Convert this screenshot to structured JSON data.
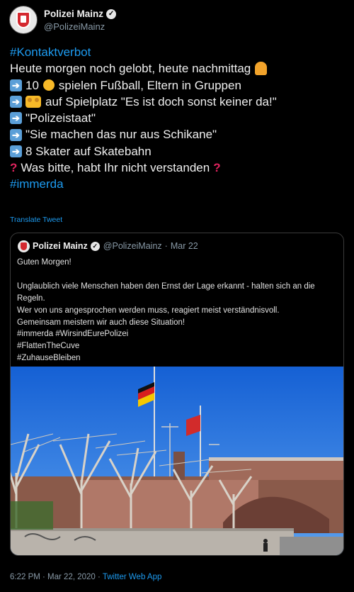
{
  "account": {
    "display_name": "Polizei Mainz",
    "handle": "@PolizeiMainz",
    "verified_mark": "✓"
  },
  "tweet": {
    "hashtag_top": "#Kontaktverbot",
    "line1": "Heute morgen noch gelobt, heute nachmittag",
    "line2_num": "10",
    "line2_text": "spielen Fußball, Eltern in Gruppen",
    "line3_text": "auf Spielplatz \"Es ist doch sonst keiner da!\"",
    "line4_text": "\"Polizeistaat\"",
    "line5_text": "\"Sie machen das nur aus Schikane\"",
    "line6_text": "8 Skater auf Skatebahn",
    "line7_text": "Was bitte, habt Ihr nicht verstanden",
    "hashtag_bottom": "#immerda",
    "icons": [
      "arrow-right-icon",
      "face-emoji",
      "people-emoji",
      "facepalm-emoji",
      "question-mark-icon"
    ]
  },
  "translate_label": "Translate Tweet",
  "quoted": {
    "display_name": "Polizei Mainz",
    "handle": "@PolizeiMainz",
    "date": "Mar 22",
    "separator": "·",
    "lines": [
      "Guten Morgen!",
      "",
      "Unglaublich viele Menschen haben den Ernst der Lage erkannt - halten sich an die Regeln.",
      "Wer von uns angesprochen werden muss, reagiert meist verständnisvoll.",
      "Gemeinsam meistern wir auch diese Situation!",
      "#immerda #WirsindEurePolizei",
      "#FlattenTheCuve",
      "#ZuhauseBleiben"
    ]
  },
  "footer": {
    "timestamp": "6:22 PM · Mar 22, 2020 ·",
    "source": "Twitter Web App"
  },
  "colors": {
    "background": "#000000",
    "link": "#1d9bf0",
    "muted": "#8899a6",
    "sky": "#1f73e0"
  }
}
